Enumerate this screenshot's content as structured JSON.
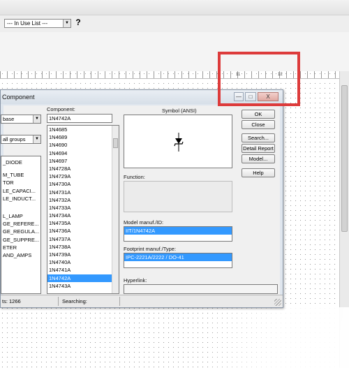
{
  "toolbar": {
    "list_select_value": "--- In Use List ---",
    "help_label": "?"
  },
  "ruler": {
    "marks": [
      "11",
      "12"
    ]
  },
  "dialog": {
    "title": "Component",
    "win_buttons": {
      "minimize": "—",
      "maximize": "□",
      "close": "X"
    },
    "database_value": "base",
    "group_value": "all groups",
    "families": [
      "_DIODE",
      "",
      "M_TUBE",
      "TOR",
      "LE_CAPACI...",
      "LE_INDUCT...",
      "",
      "",
      "L_LAMP",
      "GE_REFERE...",
      "GE_REGULA...",
      "GE_SUPPRE...",
      "ETER",
      "AND_AMPS"
    ],
    "component_label": "Component:",
    "component_value": "1N4742A",
    "components": [
      "1N4685",
      "1N4689",
      "1N4690",
      "1N4694",
      "1N4697",
      "1N4728A",
      "1N4729A",
      "1N4730A",
      "1N4731A",
      "1N4732A",
      "1N4733A",
      "1N4734A",
      "1N4735A",
      "1N4736A",
      "1N4737A",
      "1N4738A",
      "1N4739A",
      "1N4740A",
      "1N4741A",
      "1N4742A",
      "1N4743A"
    ],
    "selected_component": "1N4742A",
    "symbol_label": "Symbol (ANSI)",
    "function_label": "Function:",
    "model_label": "Model manuf./ID:",
    "model_value": "IIT/1N4742A",
    "footprint_label": "Footprint manuf./Type:",
    "footprint_value": "IPC-2221A/2222 / DO-41",
    "hyperlink_label": "Hyperlink:",
    "buttons": {
      "ok": "OK",
      "close": "Close",
      "search": "Search...",
      "detail_report": "Detail Report",
      "model": "Model...",
      "help": "Help"
    },
    "status": {
      "components_count": "ts: 1266",
      "searching": "Searching:"
    }
  }
}
